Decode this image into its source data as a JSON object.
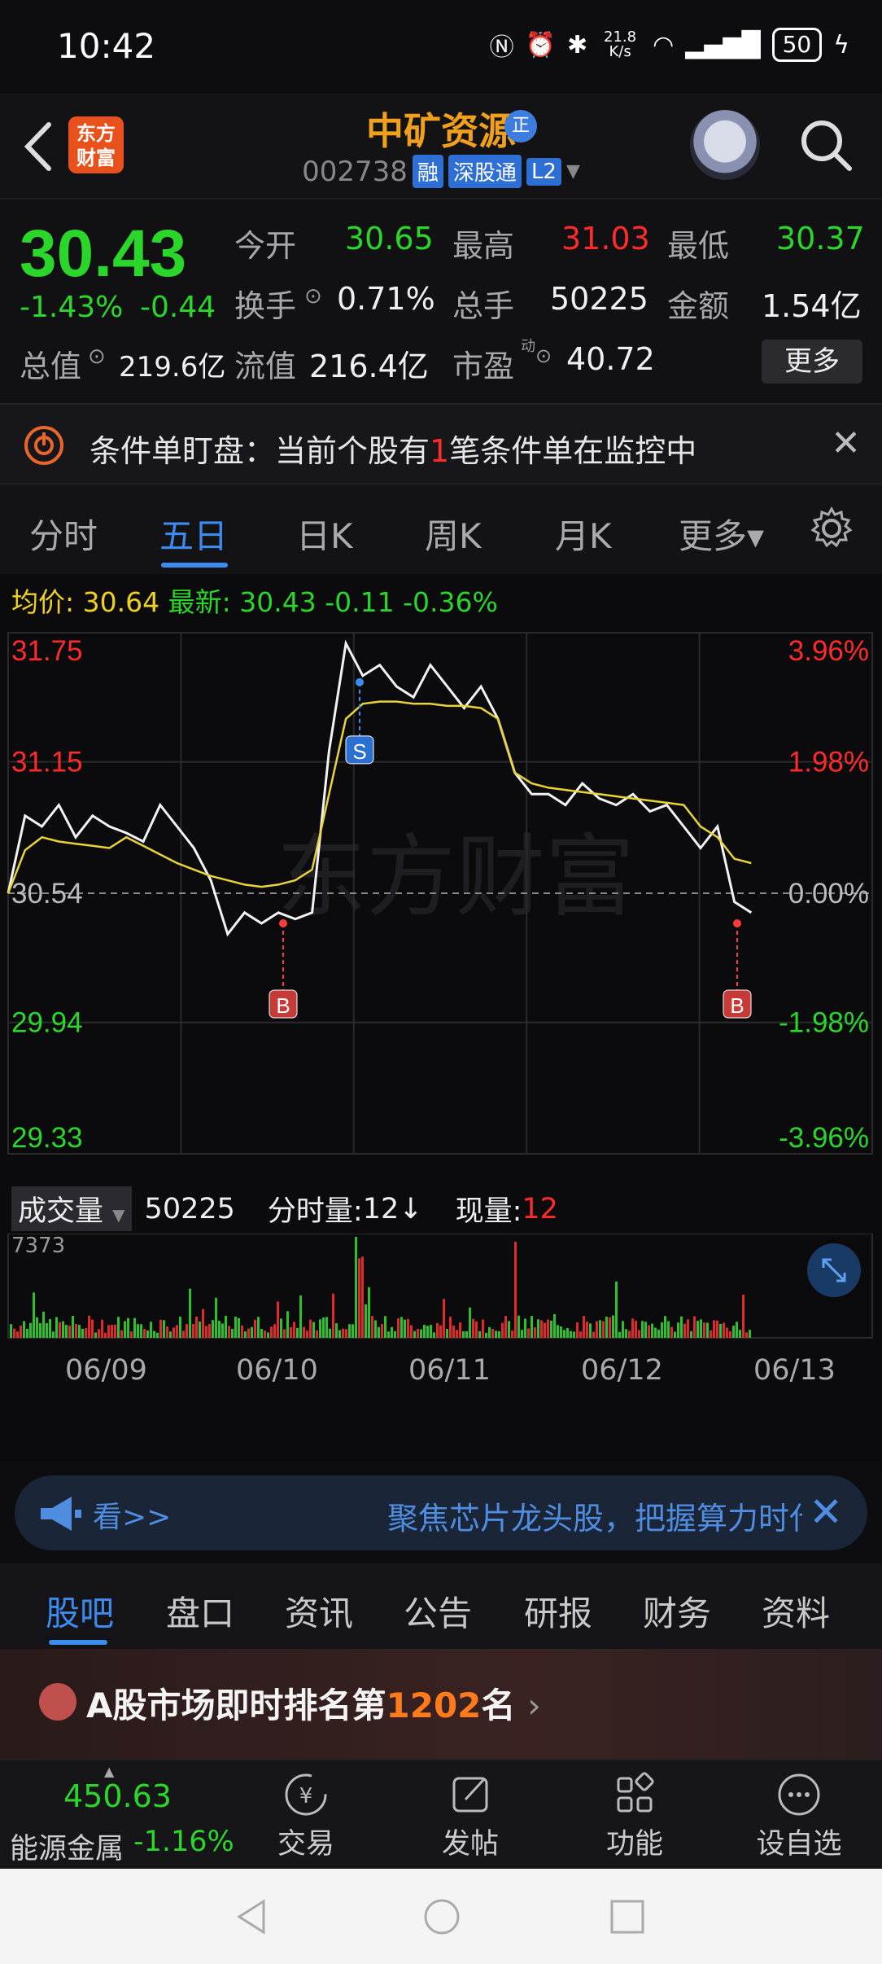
{
  "status_bar": {
    "time": "10:42",
    "net_speed": "21.8 K/s",
    "battery": "50"
  },
  "header": {
    "logo_text": "东方财富",
    "stock_name": "中矿资源",
    "name_badge": "正",
    "stock_code": "002738",
    "tags": [
      "融",
      "深股通",
      "L2"
    ]
  },
  "quote": {
    "price": "30.43",
    "change_pct": "-1.43%",
    "change_abs": "-0.44",
    "open_label": "今开",
    "open": "30.65",
    "high_label": "最高",
    "high": "31.03",
    "low_label": "最低",
    "low": "30.37",
    "turnover_label": "换手",
    "turnover": "0.71%",
    "volume_label": "总手",
    "volume": "50225",
    "amount_label": "金额",
    "amount": "1.54亿",
    "mktcap_label": "总值",
    "mktcap": "219.6亿",
    "float_label": "流值",
    "float_cap": "216.4亿",
    "pe_label": "市盈",
    "pe_sup": "动",
    "pe": "40.72",
    "more_label": "更多"
  },
  "alert": {
    "prefix": "条件单盯盘：当前个股有",
    "count": "1",
    "suffix": "笔条件单在监控中"
  },
  "tabs": [
    "分时",
    "五日",
    "日K",
    "周K",
    "月K",
    "更多▾"
  ],
  "active_tab": "五日",
  "chart_header": {
    "avg_label": "均价:",
    "avg_value": "30.64",
    "latest_label": "最新:",
    "latest_value": "30.43",
    "latest_chg": "-0.11",
    "latest_pct": "-0.36%"
  },
  "watermark": "东方财富",
  "volume_header": {
    "vol_select": "成交量",
    "vol_total": "50225",
    "tick_label": "分时量:",
    "tick_value": "12↓",
    "now_label": "现量:",
    "now_value": "12",
    "max_label": "7373"
  },
  "chart_data": {
    "type": "line",
    "title": "",
    "x": [
      "06/09",
      "06/10",
      "06/11",
      "06/12",
      "06/13"
    ],
    "y_left_ticks": [
      "31.75",
      "31.15",
      "30.54",
      "29.94",
      "29.33"
    ],
    "y_right_ticks": [
      "3.96%",
      "1.98%",
      "0.00%",
      "-1.98%",
      "-3.96%"
    ],
    "ylim": [
      29.33,
      31.75
    ],
    "baseline": 30.54,
    "series": [
      {
        "values": [
          30.54,
          30.9,
          30.85,
          30.95,
          30.8,
          30.9,
          30.85,
          30.82,
          30.78,
          30.95,
          30.85,
          30.75,
          30.6,
          30.35,
          30.45,
          30.4,
          30.45,
          30.42,
          30.45,
          31.2,
          31.7,
          31.55,
          31.6,
          31.5,
          31.45,
          31.6,
          31.5,
          31.4,
          31.5,
          31.35,
          31.1,
          31.0,
          31.0,
          30.95,
          31.05,
          30.98,
          30.95,
          31.0,
          30.92,
          30.95,
          30.85,
          30.75,
          30.85,
          30.5,
          30.45
        ]
      },
      {
        "values": [
          30.54,
          30.74,
          30.8,
          30.78,
          30.77,
          30.76,
          30.75,
          30.8,
          30.76,
          30.72,
          30.68,
          30.65,
          30.62,
          30.6,
          30.58,
          30.57,
          30.58,
          30.6,
          30.65,
          31.0,
          31.35,
          31.42,
          31.43,
          31.43,
          31.42,
          31.42,
          31.41,
          31.41,
          31.4,
          31.35,
          31.1,
          31.05,
          31.03,
          31.02,
          31.01,
          31.0,
          30.99,
          30.98,
          30.97,
          30.96,
          30.95,
          30.85,
          30.8,
          30.7,
          30.68
        ]
      }
    ],
    "volume_max": 7373,
    "markers": [
      {
        "label": "B",
        "type": "buy"
      },
      {
        "label": "S",
        "type": "sell"
      },
      {
        "label": "B",
        "type": "buy"
      }
    ]
  },
  "banner": {
    "prefix": "看>>",
    "text": "聚焦芯片龙头股，把握算力时代"
  },
  "sub_tabs": [
    "股吧",
    "盘口",
    "资讯",
    "公告",
    "研报",
    "财务",
    "资料"
  ],
  "rank": {
    "prefix": "A股市场即时排名第",
    "number": "1202",
    "suffix": "名",
    "arrow": "›"
  },
  "bottom_nav": {
    "index_value": "450.63",
    "index_name": "能源金属",
    "index_chg": "-1.16%",
    "items": [
      "交易",
      "发帖",
      "功能",
      "设自选"
    ]
  },
  "colors": {
    "up": "#ff2a2a",
    "down": "#2bd62b",
    "accent": "#3c8cf0",
    "brand": "#f0a01a"
  }
}
